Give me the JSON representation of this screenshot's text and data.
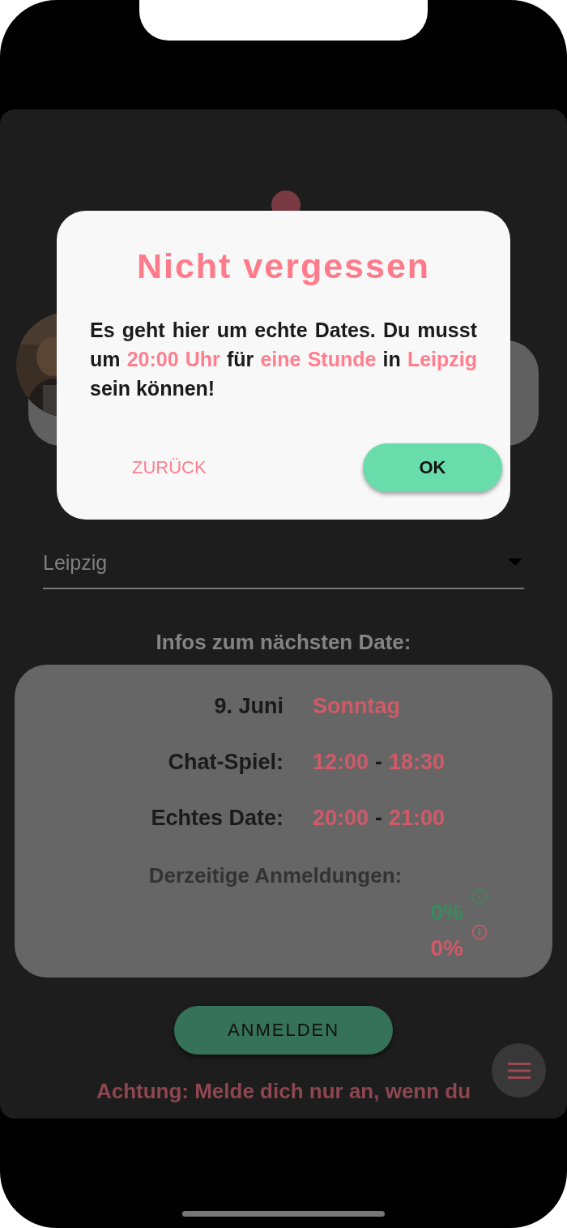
{
  "dialog": {
    "title": "Nicht vergessen",
    "message": [
      {
        "text": "Es geht hier um echte Dates. Du musst um ",
        "highlight": false
      },
      {
        "text": "20:00 Uhr",
        "highlight": true
      },
      {
        "text": " für ",
        "highlight": false
      },
      {
        "text": "eine Stunde",
        "highlight": true
      },
      {
        "text": " in ",
        "highlight": false
      },
      {
        "text": "Leipzig",
        "highlight": true
      },
      {
        "text": " sein können!",
        "highlight": false
      }
    ],
    "buttons": [
      {
        "label": "ZURÜCK",
        "kind": "text"
      },
      {
        "label": "OK",
        "kind": "filled"
      }
    ]
  },
  "city_select": {
    "value": "Leipzig"
  },
  "info_heading": "Infos zum nächsten Date:",
  "info_rows": [
    {
      "label": "9. Juni",
      "parts": [
        {
          "text": "Sonntag",
          "accent": true
        }
      ]
    },
    {
      "label": "Chat-Spiel:",
      "parts": [
        {
          "text": "12:00",
          "accent": true
        },
        {
          "text": "-",
          "accent": false
        },
        {
          "text": "18:30",
          "accent": true
        }
      ]
    },
    {
      "label": "Echtes Date:",
      "parts": [
        {
          "text": "20:00",
          "accent": true
        },
        {
          "text": "-",
          "accent": false
        },
        {
          "text": "21:00",
          "accent": true
        }
      ]
    }
  ],
  "registrations": {
    "label": "Derzeitige Anmeldungen:",
    "items": [
      {
        "value": "0%",
        "color": "#3b8a5f"
      },
      {
        "value": "0%",
        "color": "#d05a68"
      }
    ]
  },
  "register_button": "ANMELDEN",
  "warning": [
    "Achtung: Melde dich nur an, wenn du"
  ]
}
